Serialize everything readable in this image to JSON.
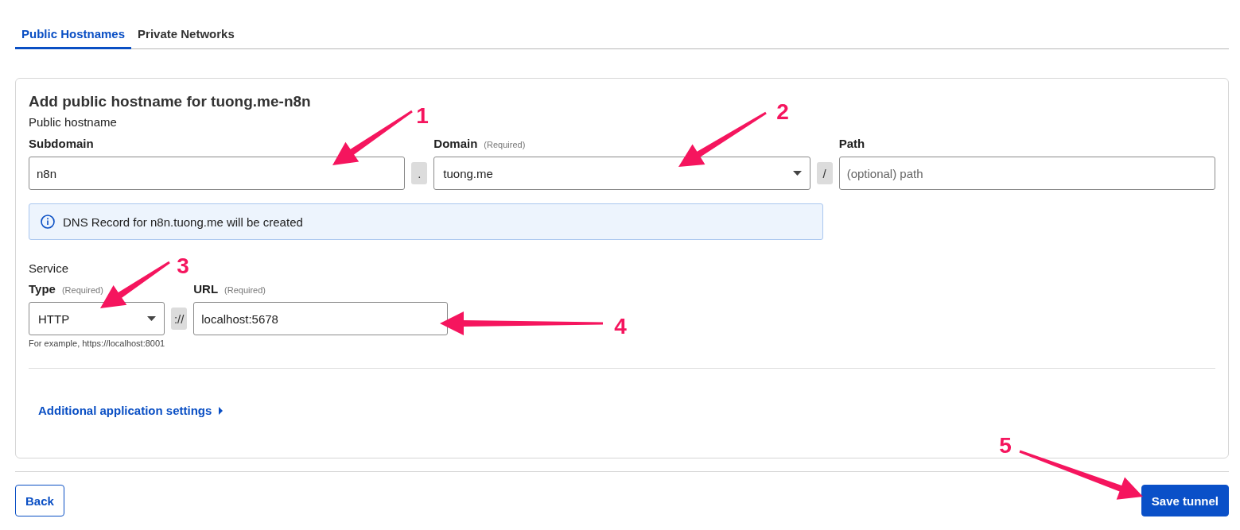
{
  "tabs": [
    {
      "label": "Public Hostnames",
      "selected": true
    },
    {
      "label": "Private Networks",
      "selected": false
    }
  ],
  "card": {
    "title": "Add public hostname for tuong.me-n8n",
    "section": "Public hostname",
    "fields": [
      {
        "kind": "text",
        "label": "Subdomain",
        "value": "n8n"
      },
      {
        "kind": "separator",
        "text": "."
      },
      {
        "kind": "select",
        "label": "Domain",
        "required": "(Required)",
        "value": "tuong.me"
      },
      {
        "kind": "separator",
        "text": "/"
      },
      {
        "kind": "text",
        "label": "Path",
        "placeholder": "(optional) path"
      }
    ],
    "info": "DNS Record for n8n.tuong.me will be created",
    "service": {
      "title": "Service",
      "fields": [
        {
          "kind": "select",
          "label": "Type",
          "required": "(Required)",
          "value": "HTTP",
          "hint": "For example, https://localhost:8001"
        },
        {
          "kind": "separator",
          "text": "://"
        },
        {
          "kind": "text",
          "label": "URL",
          "required": "(Required)",
          "value": "localhost:5678"
        }
      ]
    },
    "expander": {
      "label": "Additional application settings",
      "expanded": false
    }
  },
  "buttons": [
    {
      "kind": "secondary",
      "label": "Back"
    },
    {
      "kind": "primary",
      "label": "Save tunnel"
    }
  ],
  "annotations": [
    {
      "label": "1"
    },
    {
      "label": "2"
    },
    {
      "label": "3"
    },
    {
      "label": "4"
    },
    {
      "label": "5"
    }
  ]
}
